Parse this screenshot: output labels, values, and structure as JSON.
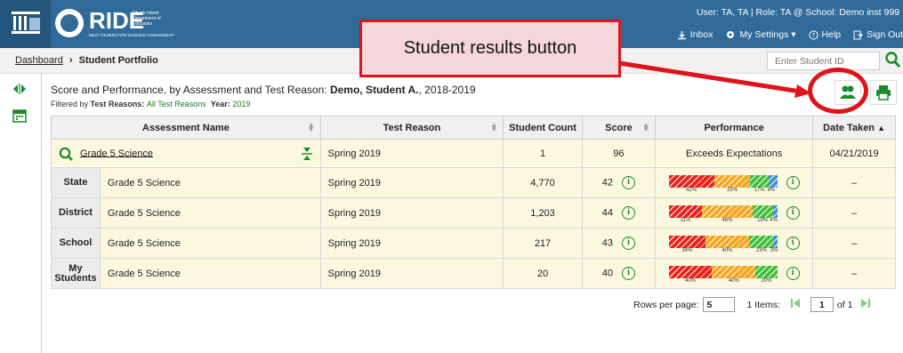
{
  "header": {
    "brand_name": "RIDE",
    "brand_sub": "Rhode Island Department of Education",
    "brand_tag": "NEXT GENERATION SCIENCE ASSESSMENT",
    "user_line": "User: TA, TA  |  Role: TA @ School: Demo inst 999",
    "links": [
      "Inbox",
      "My Settings ▾",
      "Help",
      "Sign Out"
    ]
  },
  "callout": {
    "text": "Student results button"
  },
  "breadcrumb": {
    "home": "Dashboard",
    "separator": "›",
    "current": "Student Portfolio"
  },
  "search": {
    "placeholder": "Enter Student ID"
  },
  "title": {
    "prefix": "Score and Performance, by Assessment and Test Reason: ",
    "student": "Demo, Student A.",
    "suffix": ", 2018-2019"
  },
  "filter": {
    "prefix": "Filtered by ",
    "reasons_label": "Test Reasons: ",
    "reasons_value": "All Test Reasons",
    "year_label": "Year: ",
    "year_value": "2019"
  },
  "table": {
    "headers": [
      "Assessment Name",
      "Test Reason",
      "Student Count",
      "Score",
      "Performance",
      "Date Taken"
    ],
    "main_row": {
      "assessment": "Grade 5 Science",
      "reason": "Spring 2019",
      "count": "1",
      "score": "96",
      "performance": "Exceeds Expectations",
      "date": "04/21/2019"
    },
    "rows": [
      {
        "level": "State",
        "assessment": "Grade 5 Science",
        "reason": "Spring 2019",
        "count": "4,770",
        "score": "42",
        "segments": [
          42,
          33,
          17,
          8
        ],
        "labels": [
          "42%",
          "33%",
          "17%",
          "8%"
        ],
        "date": "–"
      },
      {
        "level": "District",
        "assessment": "Grade 5 Science",
        "reason": "Spring 2019",
        "count": "1,203",
        "score": "44",
        "segments": [
          31,
          46,
          19,
          4
        ],
        "labels": [
          "31%",
          "46%",
          "19%",
          "4%"
        ],
        "date": "–"
      },
      {
        "level": "School",
        "assessment": "Grade 5 Science",
        "reason": "Spring 2019",
        "count": "217",
        "score": "43",
        "segments": [
          34,
          40,
          23,
          3
        ],
        "labels": [
          "34%",
          "40%",
          "23%",
          "3%"
        ],
        "date": "–"
      },
      {
        "level": "My Students",
        "assessment": "Grade 5 Science",
        "reason": "Spring 2019",
        "count": "20",
        "score": "40",
        "segments": [
          40,
          40,
          20,
          0
        ],
        "labels": [
          "40%",
          "40%",
          "20%",
          ""
        ],
        "date": "–"
      }
    ]
  },
  "pager": {
    "rows_label": "Rows per page:",
    "rows_value": "5",
    "items_label": "1 Items:",
    "page_value": "1",
    "of_label": "of 1"
  },
  "colors": {
    "header": "#2f6a98",
    "row_bg": "#fcf8e0",
    "red": "#e8231d",
    "orange": "#f5a623",
    "green": "#3fbf3f",
    "blue": "#3a8fd6",
    "callout_red": "#e0131a",
    "accent_green": "#1b8a2a"
  }
}
